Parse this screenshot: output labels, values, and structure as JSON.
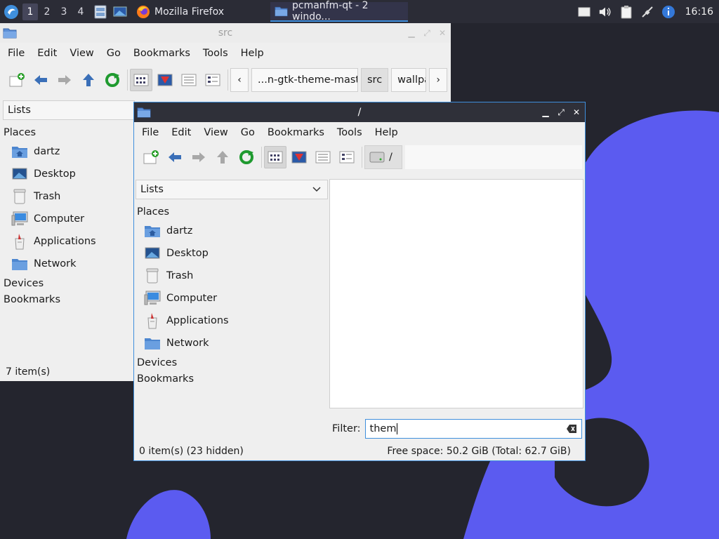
{
  "taskbar": {
    "workspaces": [
      "1",
      "2",
      "3",
      "4"
    ],
    "tasks": [
      {
        "label": "Mozilla Firefox",
        "icon": "firefox-icon"
      },
      {
        "label": "pcmanfm-qt - 2 windo...",
        "icon": "folder-icon"
      }
    ],
    "clock": "16:16"
  },
  "back_window": {
    "title": "src",
    "menu": [
      "File",
      "Edit",
      "View",
      "Go",
      "Bookmarks",
      "Tools",
      "Help"
    ],
    "breadcrumbs": [
      "...n-gtk-theme-master",
      "src",
      "wallpa..."
    ],
    "side_pane_mode": "Lists",
    "sections": {
      "places": "Places",
      "devices": "Devices",
      "bookmarks": "Bookmarks"
    },
    "places": [
      "dartz",
      "Desktop",
      "Trash",
      "Computer",
      "Applications",
      "Network"
    ],
    "status": "7 item(s)"
  },
  "front_window": {
    "title": "/",
    "menu": [
      "File",
      "Edit",
      "View",
      "Go",
      "Bookmarks",
      "Tools",
      "Help"
    ],
    "path": "/",
    "side_pane_mode": "Lists",
    "sections": {
      "places": "Places",
      "devices": "Devices",
      "bookmarks": "Bookmarks"
    },
    "places": [
      "dartz",
      "Desktop",
      "Trash",
      "Computer",
      "Applications",
      "Network"
    ],
    "filter_label": "Filter:",
    "filter_value": "them",
    "status_left": "0 item(s) (23 hidden)",
    "status_right": "Free space: 50.2 GiB (Total: 62.7 GiB)"
  },
  "colors": {
    "accent": "#3f8fdc",
    "wallpaper_blob": "#5b5bf0",
    "desktop": "#24252e"
  }
}
